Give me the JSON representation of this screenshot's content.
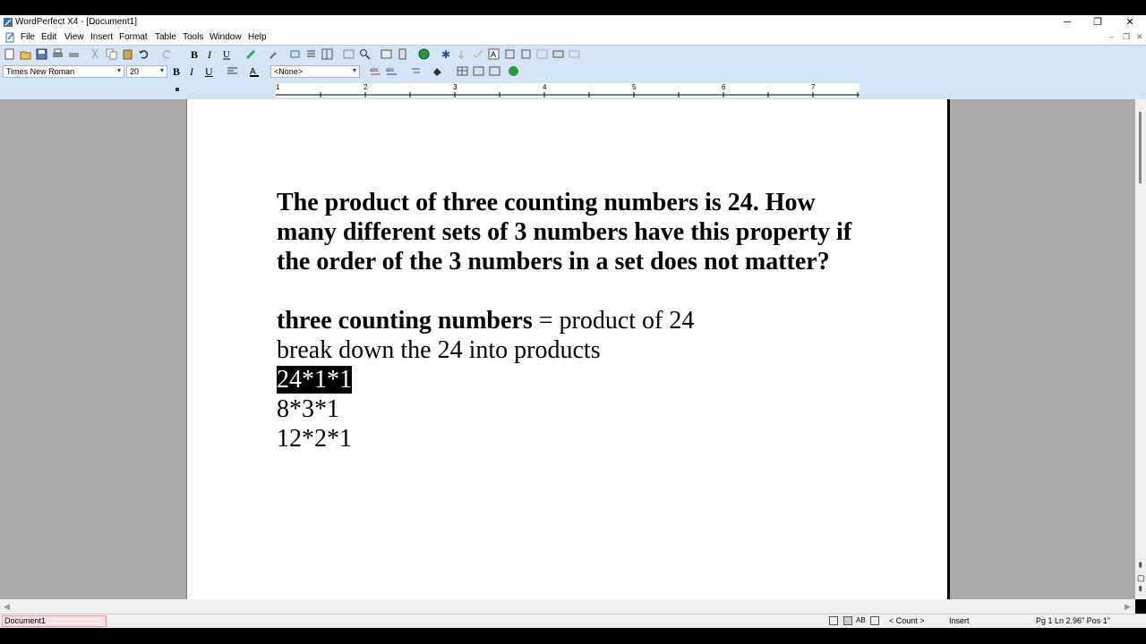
{
  "window": {
    "title": "WordPerfect X4 - [Document1]",
    "minimize": "─",
    "restore": "❐",
    "close": "✕"
  },
  "menu": {
    "items": [
      "File",
      "Edit",
      "View",
      "Insert",
      "Format",
      "Table",
      "Tools",
      "Window",
      "Help"
    ],
    "doc_min": "–",
    "doc_restore": "❐",
    "doc_close": "✕"
  },
  "toolbar": {
    "font_name": "Times New Roman",
    "font_size": "20",
    "style": "<None>",
    "bold": "B",
    "italic": "I",
    "underline": "U"
  },
  "ruler": {
    "labels": [
      "1",
      "2",
      "3",
      "4",
      "5",
      "6",
      "7"
    ]
  },
  "document": {
    "question_line1": "The product of three counting numbers is 24. How",
    "question_line2": "many different sets of 3 numbers have this property if",
    "question_line3": "the order of the 3 numbers in a set does not matter?",
    "line1_bold": "three counting numbers",
    "line1_rest": " = product of 24",
    "line2": "break down the 24 into products",
    "line3": "24*1*1",
    "line4": "8*3*1",
    "line5": "12*2*1"
  },
  "statusbar": {
    "doc_tab": "Document1",
    "count": "< Count >",
    "mode": "Insert",
    "position": "Pg 1 Ln 2.96\" Pos 1\""
  },
  "colors": {
    "toolbar_bg": "#d5e4f5",
    "workspace_bg": "#ababab",
    "doc_tab_bg": "#fde3e3"
  }
}
